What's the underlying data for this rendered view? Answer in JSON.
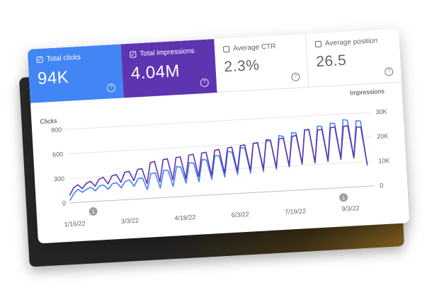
{
  "metrics": {
    "clicks": {
      "label": "Total clicks",
      "value": "94K",
      "color": "#4285f4"
    },
    "impressions": {
      "label": "Total impressions",
      "value": "4.04M",
      "color": "#5e35b1"
    },
    "ctr": {
      "label": "Average CTR",
      "value": "2.3%"
    },
    "position": {
      "label": "Average position",
      "value": "26.5"
    }
  },
  "chart_data": {
    "type": "line",
    "left_axis": {
      "title": "Clicks",
      "ticks": [
        "900",
        "600",
        "300",
        "0"
      ],
      "ylim": [
        0,
        900
      ]
    },
    "right_axis": {
      "title": "Impressions",
      "ticks": [
        "30K",
        "20K",
        "10K",
        "0"
      ],
      "ylim": [
        0,
        30000
      ]
    },
    "x_ticks": [
      "1/16/22",
      "3/3/22",
      "4/18/22",
      "6/3/22",
      "7/19/22",
      "9/3/22"
    ],
    "grid": true,
    "annotations": [
      "1",
      "1"
    ],
    "series": [
      {
        "metric": "clicks",
        "color": "#4285f4",
        "values": [
          30,
          110,
          160,
          120,
          155,
          175,
          130,
          185,
          195,
          140,
          205,
          215,
          150,
          225,
          240,
          160,
          250,
          255,
          110,
          300,
          310,
          120,
          335,
          330,
          130,
          370,
          360,
          160,
          410,
          400,
          170,
          440,
          430,
          190,
          480,
          470,
          210,
          520,
          510,
          230,
          560,
          545,
          240,
          605,
          600,
          250,
          640,
          630,
          270,
          680,
          665,
          290,
          705,
          700,
          320,
          735,
          725,
          320,
          770,
          760,
          340,
          795,
          790,
          360,
          830,
          820,
          360,
          810,
          800,
          250
        ]
      },
      {
        "metric": "impressions",
        "color": "#5e35b1",
        "values": [
          3000,
          6000,
          7200,
          5500,
          7600,
          8300,
          6200,
          9000,
          9600,
          6800,
          10000,
          10500,
          7200,
          11200,
          11500,
          7600,
          12100,
          12300,
          6000,
          14500,
          15000,
          6500,
          15500,
          15700,
          7000,
          16000,
          16200,
          7200,
          16700,
          17000,
          7800,
          17300,
          17500,
          8000,
          18000,
          18400,
          8500,
          18800,
          19000,
          9000,
          19400,
          19600,
          9200,
          20000,
          20300,
          9500,
          20700,
          21000,
          9800,
          21300,
          21500,
          10000,
          21900,
          22400,
          10500,
          24300,
          24500,
          10800,
          24000,
          24200,
          11000,
          24700,
          24900,
          11500,
          24900,
          25100,
          11800,
          24400,
          24200,
          9000
        ]
      }
    ]
  }
}
